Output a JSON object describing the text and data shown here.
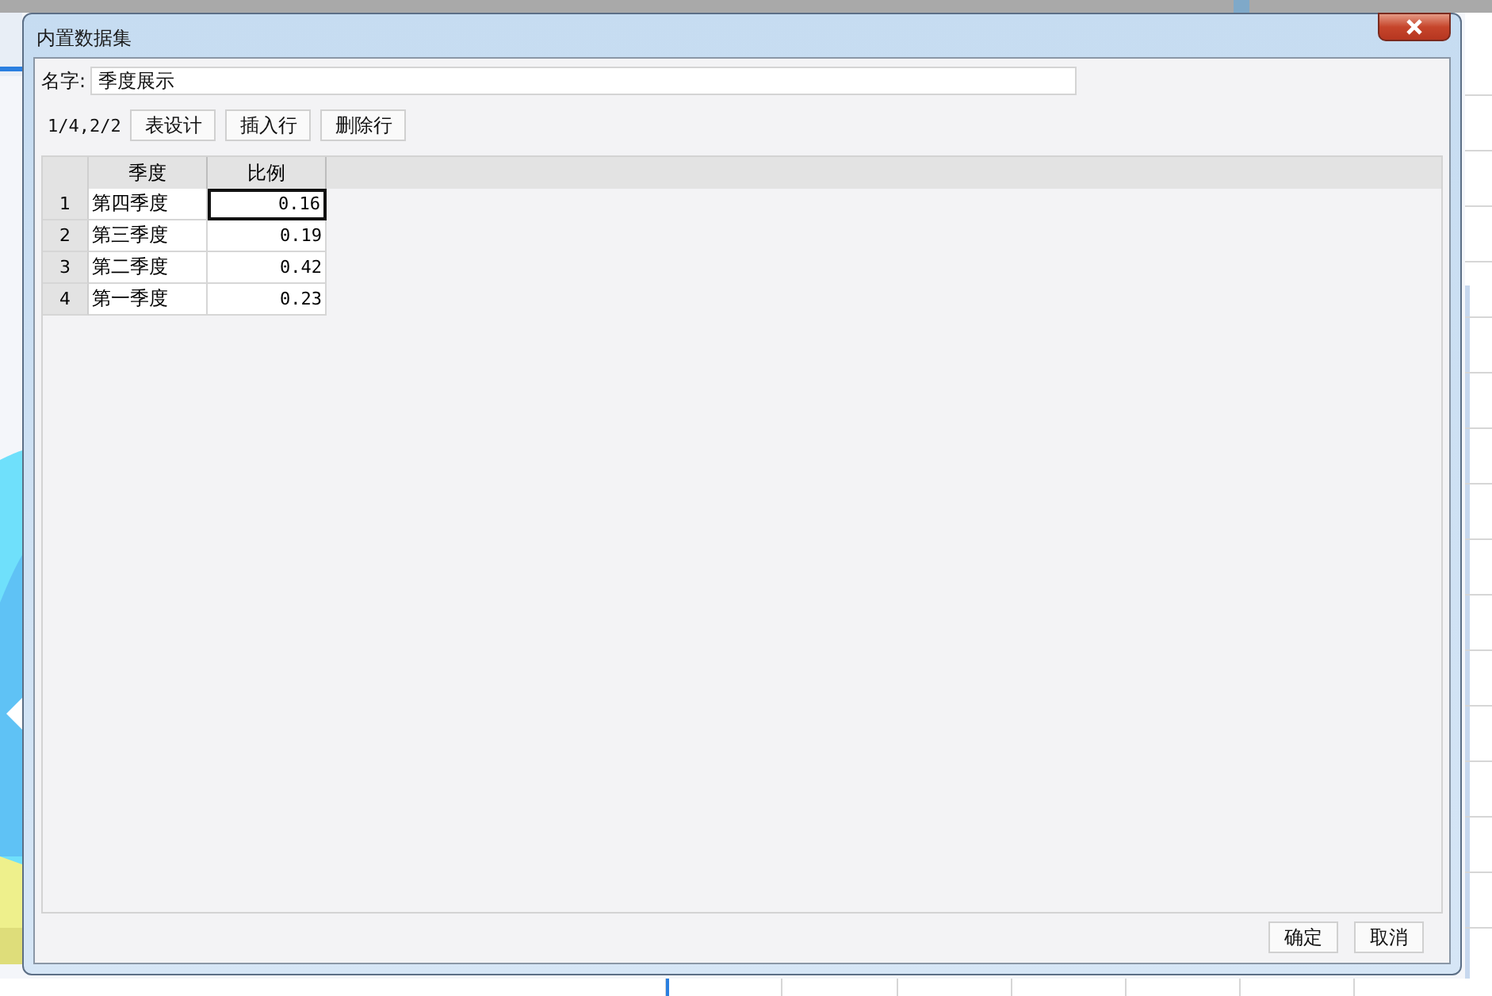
{
  "window": {
    "title": "内置数据集"
  },
  "name_field": {
    "label": "名字:",
    "value": "季度展示"
  },
  "toolbar": {
    "position": "1/4,2/2",
    "buttons": [
      "表设计",
      "插入行",
      "删除行"
    ]
  },
  "table": {
    "columns": [
      "季度",
      "比例"
    ],
    "rows": [
      {
        "number": "1",
        "cells": [
          "第四季度",
          "0.16"
        ],
        "selected": true
      },
      {
        "number": "2",
        "cells": [
          "第三季度",
          "0.19"
        ],
        "selected": false
      },
      {
        "number": "3",
        "cells": [
          "第二季度",
          "0.42"
        ],
        "selected": false
      },
      {
        "number": "4",
        "cells": [
          "第一季度",
          "0.23"
        ],
        "selected": false
      }
    ]
  },
  "buttons": [
    "确定",
    "取消"
  ]
}
